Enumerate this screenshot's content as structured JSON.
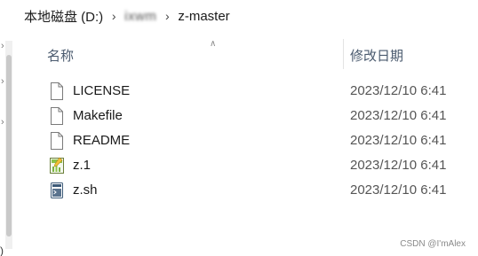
{
  "breadcrumb": {
    "items": [
      "本地磁盘 (D:)",
      "ixwm",
      "z-master"
    ]
  },
  "columns": {
    "name": "名称",
    "date_modified": "修改日期"
  },
  "files": [
    {
      "name": "LICENSE",
      "date": "2023/12/10 6:41",
      "icon": "document-icon"
    },
    {
      "name": "Makefile",
      "date": "2023/12/10 6:41",
      "icon": "document-icon"
    },
    {
      "name": "README",
      "date": "2023/12/10 6:41",
      "icon": "document-icon"
    },
    {
      "name": "z.1",
      "date": "2023/12/10 6:41",
      "icon": "manpage-chart-icon"
    },
    {
      "name": "z.sh",
      "date": "2023/12/10 6:41",
      "icon": "shell-script-icon"
    }
  ],
  "nav": {
    "partial_label": ")"
  },
  "watermark": "CSDN @I'mAlex",
  "colors": {
    "header_text": "#4a5a6e",
    "date_text": "#555555",
    "script_icon": "#3c5a78",
    "manpage_icon_green": "#8bc34a"
  }
}
